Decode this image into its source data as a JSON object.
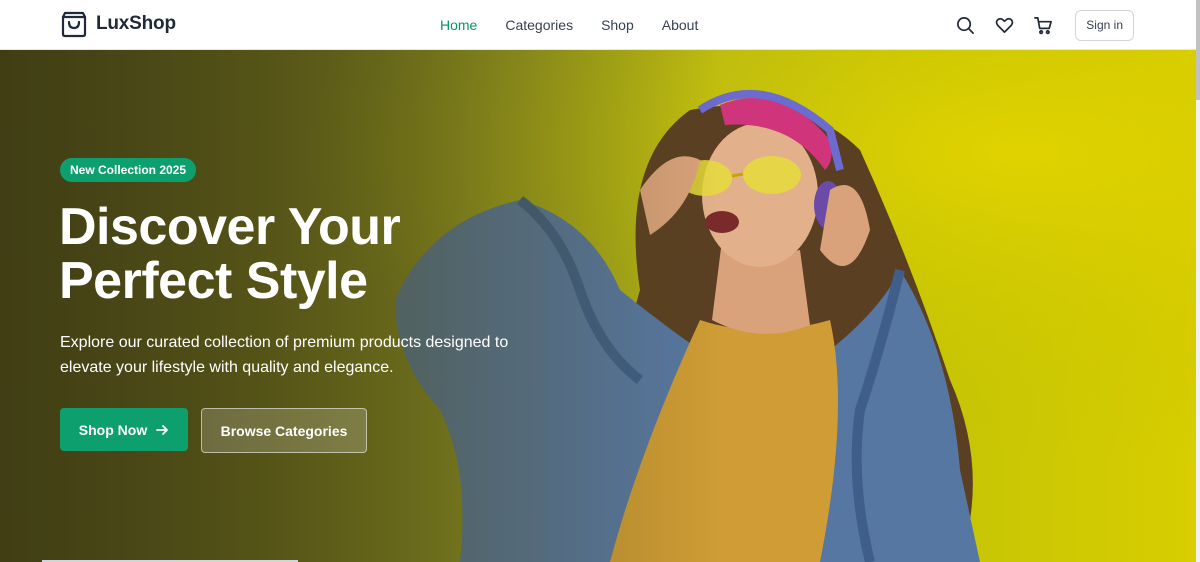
{
  "brand": {
    "name": "LuxShop",
    "icon": "shopping-bag-icon"
  },
  "nav": {
    "links": [
      {
        "label": "Home",
        "active": true
      },
      {
        "label": "Categories",
        "active": false
      },
      {
        "label": "Shop",
        "active": false
      },
      {
        "label": "About",
        "active": false
      }
    ],
    "actions": {
      "search_icon": "search-icon",
      "wishlist_icon": "heart-icon",
      "cart_icon": "cart-icon",
      "signin_label": "Sign in"
    }
  },
  "hero": {
    "badge": "New Collection 2025",
    "title_line1": "Discover Your",
    "title_line2": "Perfect Style",
    "description": "Explore our curated collection of premium products designed to elevate your lifestyle with quality and elegance.",
    "primary_button": "Shop Now",
    "primary_button_icon": "arrow-right-icon",
    "secondary_button": "Browse Categories",
    "image_subject": "woman-wearing-headphones"
  },
  "colors": {
    "accent": "#0e9f6e",
    "nav_active": "#059669",
    "hero_left": "#4a4718",
    "hero_right": "#d8ce00"
  }
}
